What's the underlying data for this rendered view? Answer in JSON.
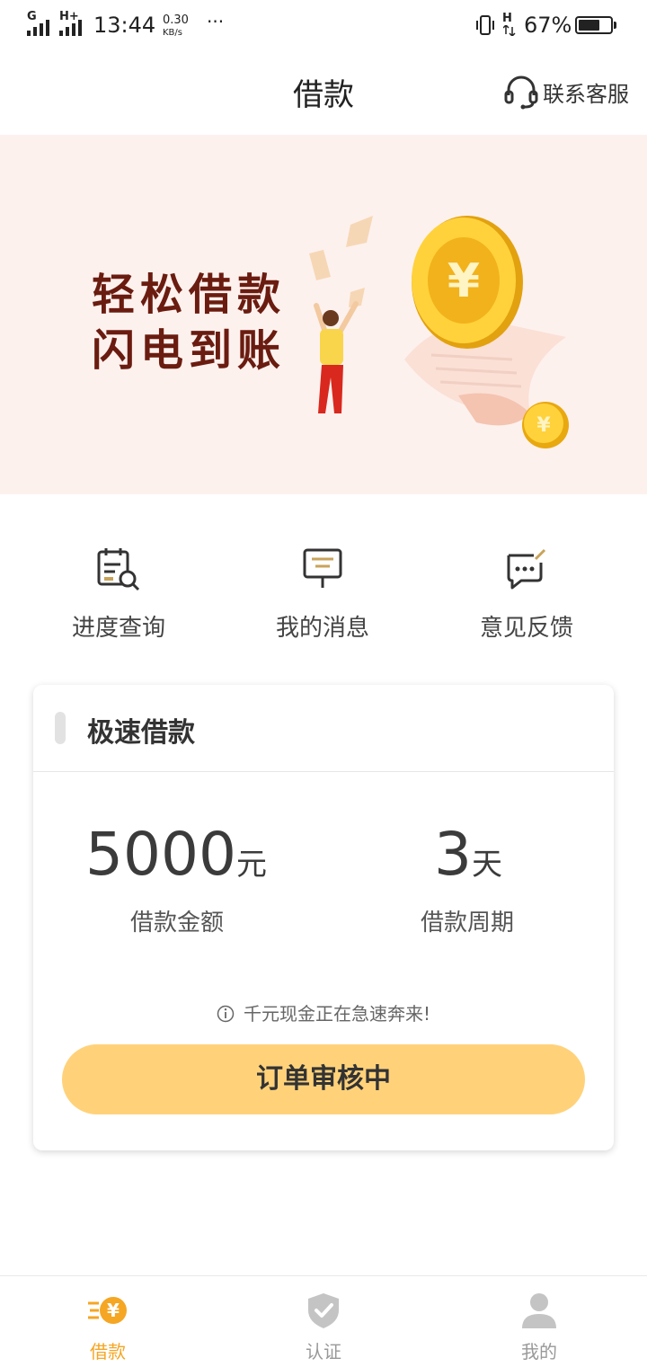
{
  "status_bar": {
    "network_1": "G",
    "network_2": "H+",
    "time": "13:44",
    "speed_value": "0.30",
    "speed_unit": "KB/s",
    "more": "···",
    "network_3": "H",
    "battery_percent": "67%",
    "battery_level": 0.67
  },
  "header": {
    "title": "借款",
    "customer_service_label": "联系客服"
  },
  "banner": {
    "line1": "轻松借款",
    "line2": "闪电到账",
    "coin_symbol": "¥"
  },
  "quick_actions": [
    {
      "label": "进度查询",
      "icon": "calendar-search-icon"
    },
    {
      "label": "我的消息",
      "icon": "message-board-icon"
    },
    {
      "label": "意见反馈",
      "icon": "feedback-chat-icon"
    }
  ],
  "loan_card": {
    "title": "极速借款",
    "amount_value": "5000",
    "amount_unit": "元",
    "amount_label": "借款金额",
    "period_value": "3",
    "period_unit": "天",
    "period_label": "借款周期",
    "tip": "千元现金正在急速奔来!",
    "button_label": "订单审核中"
  },
  "tab_bar": {
    "active_color": "#f5a623",
    "tabs": [
      {
        "label": "借款",
        "icon": "loan-yen-icon",
        "active": true
      },
      {
        "label": "认证",
        "icon": "shield-check-icon",
        "active": false
      },
      {
        "label": "我的",
        "icon": "user-icon",
        "active": false
      }
    ]
  }
}
